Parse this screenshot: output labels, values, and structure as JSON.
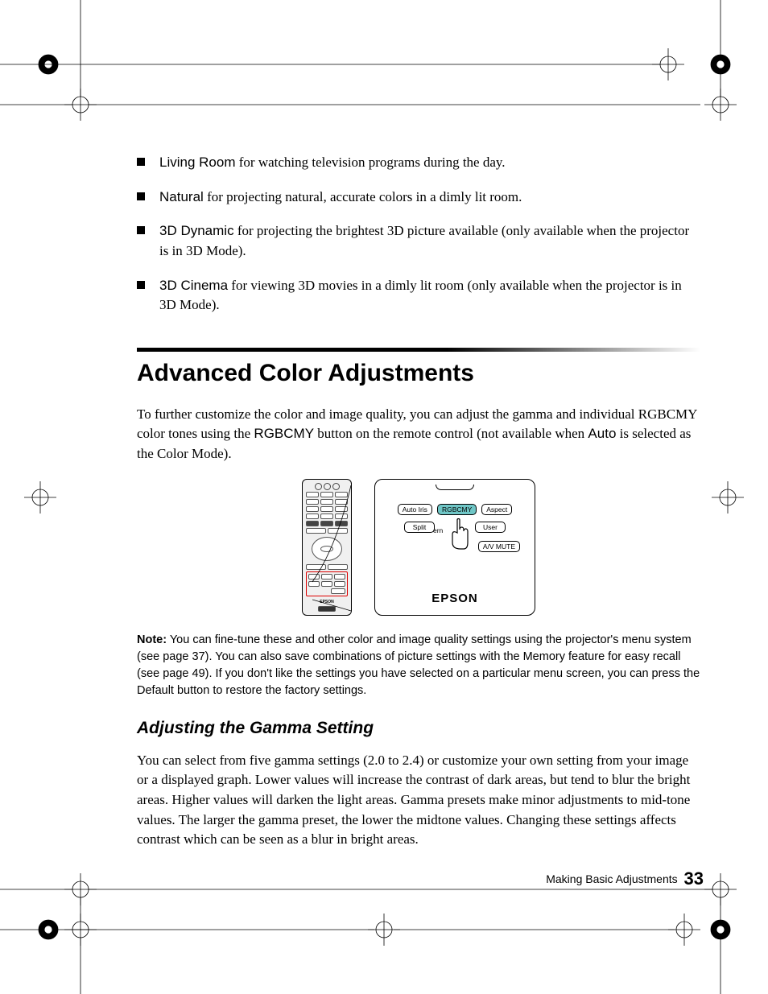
{
  "modes": [
    {
      "label": "Living Room",
      "desc": " for watching television programs during the day."
    },
    {
      "label": "Natural",
      "desc": " for projecting natural, accurate colors in a dimly lit room."
    },
    {
      "label": "3D Dynamic",
      "desc": " for projecting the brightest 3D picture available (only available when the projector is in 3D Mode)."
    },
    {
      "label": "3D Cinema",
      "desc": " for viewing 3D movies in a dimly lit room (only available when the projector is in 3D Mode)."
    }
  ],
  "section": {
    "title": "Advanced Color Adjustments",
    "intro_a": "To further customize the color and image quality, you can adjust the gamma and individual RGBCMY color tones using the ",
    "intro_b": "RGBCMY",
    "intro_c": " button on the remote control (not available when ",
    "intro_d": "Auto",
    "intro_e": " is selected as the Color Mode)."
  },
  "remote": {
    "buttons": {
      "auto_iris": "Auto Iris",
      "rgbcmy": "RGBCMY",
      "aspect": "Aspect",
      "split": "Split",
      "pattern_frag": "ern",
      "user": "User",
      "av_mute": "A/V MUTE"
    },
    "brand": "EPSON",
    "small_brand": "EPSON"
  },
  "note": {
    "label": "Note:",
    "text": " You can fine-tune these and other color and image quality settings using the projector's menu system (see page 37). You can also save combinations of picture settings with the Memory feature for easy recall (see page 49). If you don't like the settings you have selected on a particular menu screen, you can press the Default button to restore the factory settings."
  },
  "subsection": {
    "title": "Adjusting the Gamma Setting",
    "body": "You can select from five gamma settings (2.0 to 2.4) or customize your own setting from your image or a displayed graph. Lower values will increase the contrast of dark areas, but tend to blur the bright areas. Higher values will darken the light areas. Gamma presets make minor adjustments to mid-tone values. The larger the gamma preset, the lower the midtone values. Changing these settings affects contrast which can be seen as a blur in bright areas."
  },
  "footer": {
    "text": "Making Basic Adjustments",
    "page": "33"
  }
}
